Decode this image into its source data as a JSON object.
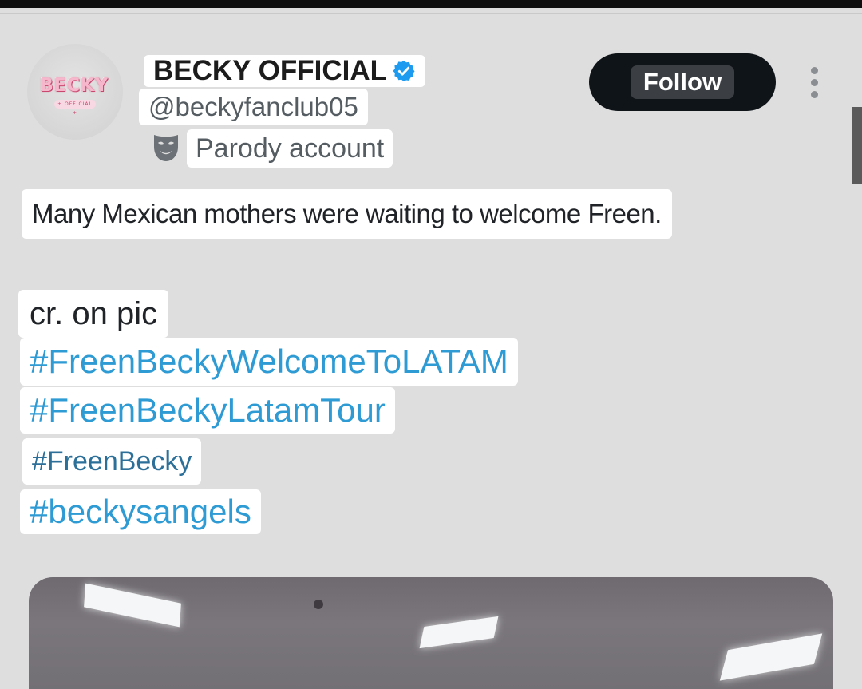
{
  "profile": {
    "display_name": "BECKY OFFICIAL",
    "handle": "@beckyfanclub05",
    "account_label": "Parody account",
    "verified": true,
    "avatar": {
      "logo_text": "BECKY",
      "logo_sub": "+ OFFICIAL +"
    }
  },
  "actions": {
    "follow_label": "Follow",
    "more_icon": "more-vertical-icon"
  },
  "tweet": {
    "text": "Many Mexican mothers were waiting to welcome Freen.",
    "credit": "cr. on pic",
    "hashtags": [
      "#FreenBeckyWelcomeToLATAM",
      "#FreenBeckyLatamTour",
      "#FreenBecky",
      "#beckysangels"
    ]
  },
  "colors": {
    "hashtag": "#2f9bd4",
    "verified": "#1d9bf0",
    "follow_bg": "#0f1419",
    "background": "#dedede"
  }
}
